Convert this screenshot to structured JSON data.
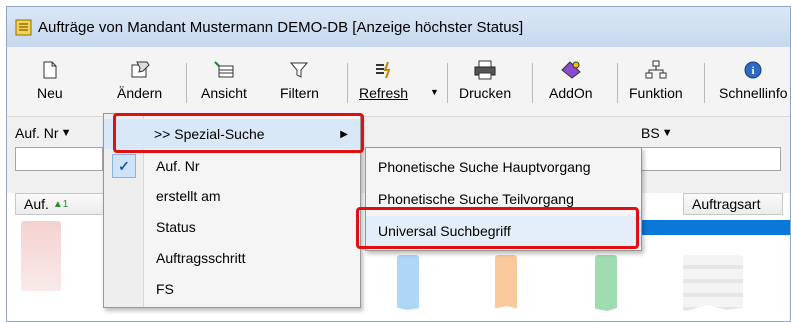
{
  "window": {
    "title": "Aufträge von Mandant  Mustermann DEMO-DB [Anzeige höchster Status]"
  },
  "toolbar": {
    "buttons": [
      {
        "label": "Neu",
        "icon": "new-document-icon"
      },
      {
        "label": "Ändern",
        "icon": "edit-icon"
      },
      {
        "label": "Ansicht",
        "icon": "view-icon"
      },
      {
        "label": "Filtern",
        "icon": "filter-icon"
      },
      {
        "label": "Refresh",
        "icon": "refresh-icon"
      },
      {
        "label": "Drucken",
        "icon": "printer-icon"
      },
      {
        "label": "AddOn",
        "icon": "addon-icon"
      },
      {
        "label": "Funktion",
        "icon": "function-icon"
      },
      {
        "label": "Schnellinfo",
        "icon": "info-icon"
      }
    ]
  },
  "filter": {
    "field_left": "Auf. Nr",
    "field_right": "BS"
  },
  "grid": {
    "headers": [
      "Auf.",
      "Auftragsart"
    ]
  },
  "context_menu": {
    "items": [
      {
        "label": ">> Spezial-Suche",
        "has_submenu": true
      },
      {
        "label": "Auf. Nr",
        "checked": true
      },
      {
        "label": "erstellt am"
      },
      {
        "label": "Status"
      },
      {
        "label": "Auftragsschritt"
      },
      {
        "label": "FS"
      }
    ]
  },
  "submenu": {
    "items": [
      {
        "label": "Phonetische Suche Hauptvorgang"
      },
      {
        "label": "Phonetische Suche Teilvorgang"
      },
      {
        "label": "Universal Suchbegriff"
      }
    ]
  },
  "colors": {
    "highlight": "#e01010",
    "selection": "#0a78d8"
  }
}
